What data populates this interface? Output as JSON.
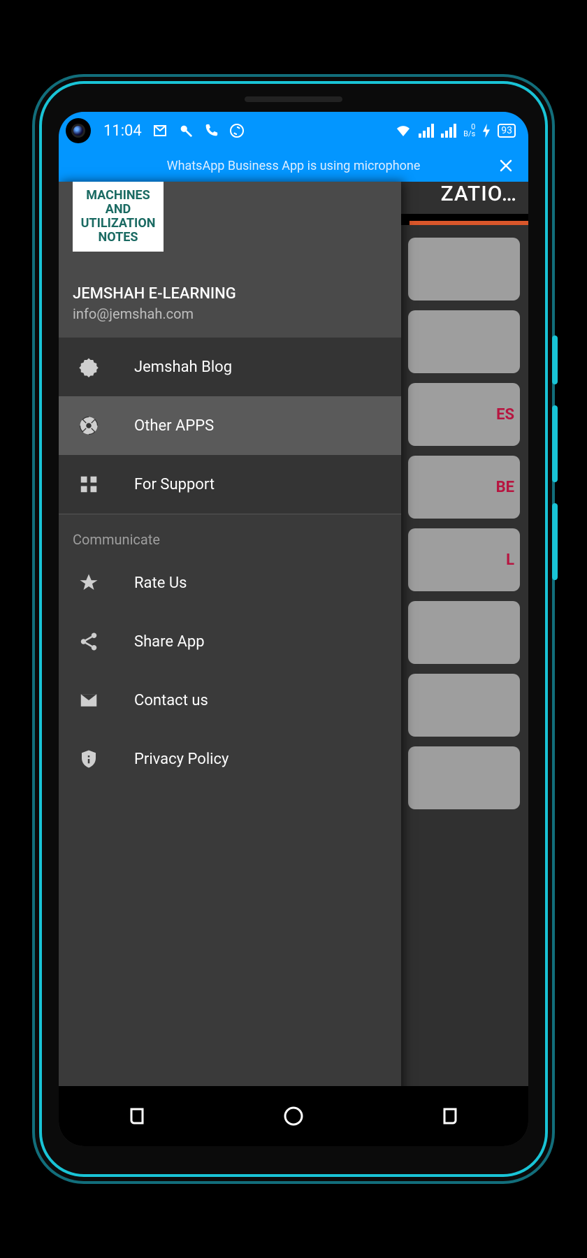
{
  "status": {
    "time": "11:04",
    "data_rate_top": "0",
    "data_rate_unit": "B/s",
    "battery": "93"
  },
  "notification": {
    "text": "WhatsApp Business App is using microphone"
  },
  "under": {
    "title_fragment": "ZATIO…",
    "cards": [
      "",
      "",
      "ES",
      "BE",
      "L",
      "",
      "",
      ""
    ]
  },
  "drawer": {
    "logo_lines": [
      "MACHINES",
      "AND",
      "UTILIZATION",
      "NOTES"
    ],
    "org": "JEMSHAH E-LEARNING",
    "email": "info@jemshah.com",
    "section1": [
      {
        "label": "Jemshah Blog",
        "selected": false
      },
      {
        "label": "Other APPS",
        "selected": true
      },
      {
        "label": "For Support",
        "selected": false
      }
    ],
    "section2_title": "Communicate",
    "section2": [
      {
        "label": "Rate Us"
      },
      {
        "label": "Share App"
      },
      {
        "label": "Contact us"
      },
      {
        "label": "Privacy Policy"
      }
    ]
  }
}
